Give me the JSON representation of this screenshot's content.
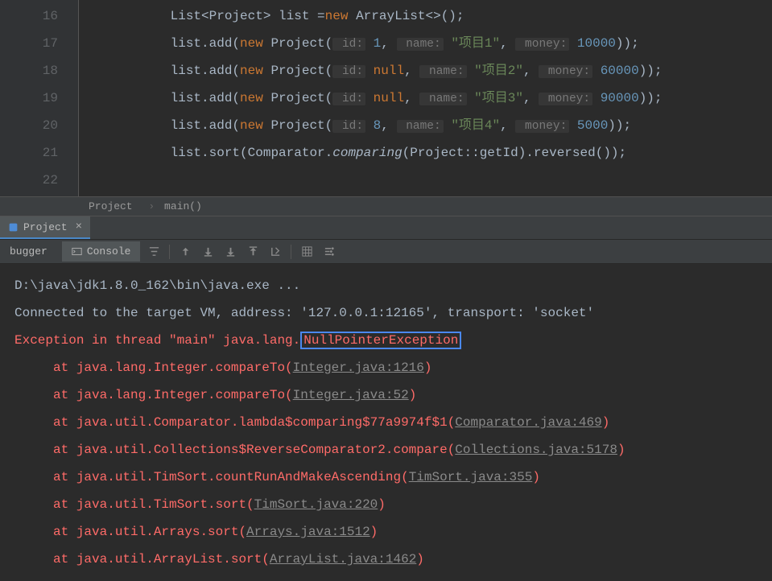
{
  "gutter": [
    "16",
    "17",
    "18",
    "19",
    "20",
    "21",
    "22"
  ],
  "code": {
    "l16": {
      "pre": "           List<Project> list =",
      "kw": "new",
      "post": " ArrayList<>();"
    },
    "l17": {
      "pre": "           list.add(",
      "kw": "new",
      "cls": " Project(",
      "h1": " id:",
      "v1": " 1",
      "c1": ",",
      "h2": " name:",
      "v2": " \"项目1\"",
      "c2": ",",
      "h3": " money:",
      "v3": " 10000",
      "end": "));"
    },
    "l18": {
      "pre": "           list.add(",
      "kw": "new",
      "cls": " Project(",
      "h1": " id:",
      "v1": " null",
      "c1": ",",
      "h2": " name:",
      "v2": " \"项目2\"",
      "c2": ",",
      "h3": " money:",
      "v3": " 60000",
      "end": "));"
    },
    "l19": {
      "pre": "           list.add(",
      "kw": "new",
      "cls": " Project(",
      "h1": " id:",
      "v1": " null",
      "c1": ",",
      "h2": " name:",
      "v2": " \"项目3\"",
      "c2": ",",
      "h3": " money:",
      "v3": " 90000",
      "end": "));"
    },
    "l20": {
      "pre": "           list.add(",
      "kw": "new",
      "cls": " Project(",
      "h1": " id:",
      "v1": " 8",
      "c1": ",",
      "h2": " name:",
      "v2": " \"项目4\"",
      "c2": ",",
      "h3": " money:",
      "v3": " 5000",
      "end": "));"
    },
    "l21": {
      "pre": "           list.sort(Comparator.",
      "m": "comparing",
      "post": "(Project::getId).reversed());"
    }
  },
  "breadcrumb": {
    "a": "Project",
    "sep": "›",
    "b": "main()"
  },
  "tab": {
    "name": "Project"
  },
  "toolbar": {
    "debugger": "bugger",
    "console": "Console"
  },
  "console": {
    "l1": "D:\\java\\jdk1.8.0_162\\bin\\java.exe ...",
    "l2": "Connected to the target VM, address: '127.0.0.1:12165', transport: 'socket'",
    "l3_a": "Exception in thread \"main\" java.lang.",
    "l3_b": "NullPointerException",
    "st": [
      {
        "pre": "     at java.lang.Integer.compareTo(",
        "link": "Integer.java:1216",
        "post": ")"
      },
      {
        "pre": "     at java.lang.Integer.compareTo(",
        "link": "Integer.java:52",
        "post": ")"
      },
      {
        "pre": "     at java.util.Comparator.lambda$comparing$77a9974f$1(",
        "link": "Comparator.java:469",
        "post": ")"
      },
      {
        "pre": "     at java.util.Collections$ReverseComparator2.compare(",
        "link": "Collections.java:5178",
        "post": ")"
      },
      {
        "pre": "     at java.util.TimSort.countRunAndMakeAscending(",
        "link": "TimSort.java:355",
        "post": ")"
      },
      {
        "pre": "     at java.util.TimSort.sort(",
        "link": "TimSort.java:220",
        "post": ")"
      },
      {
        "pre": "     at java.util.Arrays.sort(",
        "link": "Arrays.java:1512",
        "post": ")"
      },
      {
        "pre": "     at java.util.ArrayList.sort(",
        "link": "ArrayList.java:1462",
        "post": ")"
      }
    ]
  }
}
